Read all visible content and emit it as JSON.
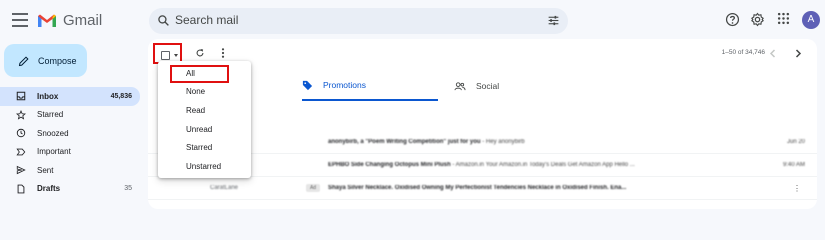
{
  "app": {
    "name": "Gmail"
  },
  "search": {
    "placeholder": "Search mail"
  },
  "user": {
    "avatar_initial": "A"
  },
  "sidebar": {
    "compose_label": "Compose",
    "items": [
      {
        "label": "Inbox",
        "count": "45,836",
        "icon": "inbox-icon",
        "active": true
      },
      {
        "label": "Starred",
        "count": "",
        "icon": "star-icon"
      },
      {
        "label": "Snoozed",
        "count": "",
        "icon": "clock-icon"
      },
      {
        "label": "Important",
        "count": "",
        "icon": "important-icon"
      },
      {
        "label": "Sent",
        "count": "",
        "icon": "send-icon"
      },
      {
        "label": "Drafts",
        "count": "35",
        "icon": "draft-icon"
      }
    ]
  },
  "toolbar": {
    "paging": "1–50 of 34,746"
  },
  "tabs": [
    {
      "label": "Promotions",
      "icon": "tag-icon",
      "active": true
    },
    {
      "label": "Social",
      "icon": "people-icon"
    }
  ],
  "select_menu": {
    "options": [
      "All",
      "None",
      "Read",
      "Unread",
      "Starred",
      "Unstarred"
    ]
  },
  "emails": [
    {
      "sender": "",
      "subject": "anonybirb, a \"Poem Writing Competition\" just for you",
      "snippet": " - Hey anonybirb",
      "date": "Jun 20"
    },
    {
      "sender": "",
      "subject": "EPHBO Side Changing Octopus Mini Plush",
      "snippet": " - Amazon.in Your Amazon.in Today's Deals Get Amazon App Hello ...",
      "date": "9:40 AM"
    },
    {
      "sender": "CaratLane",
      "tag": "Ad",
      "subject": "Shaya Silver Necklace. Oxidised Owning My Perfectionist Tendencies Necklace in Oxidised Finish. Ena...",
      "snippet": "",
      "date": ""
    }
  ],
  "colors": {
    "accent": "#0b57d0",
    "compose_bg": "#c2e7ff",
    "active_nav": "#d3e3fd",
    "highlight_border": "#e01010"
  }
}
